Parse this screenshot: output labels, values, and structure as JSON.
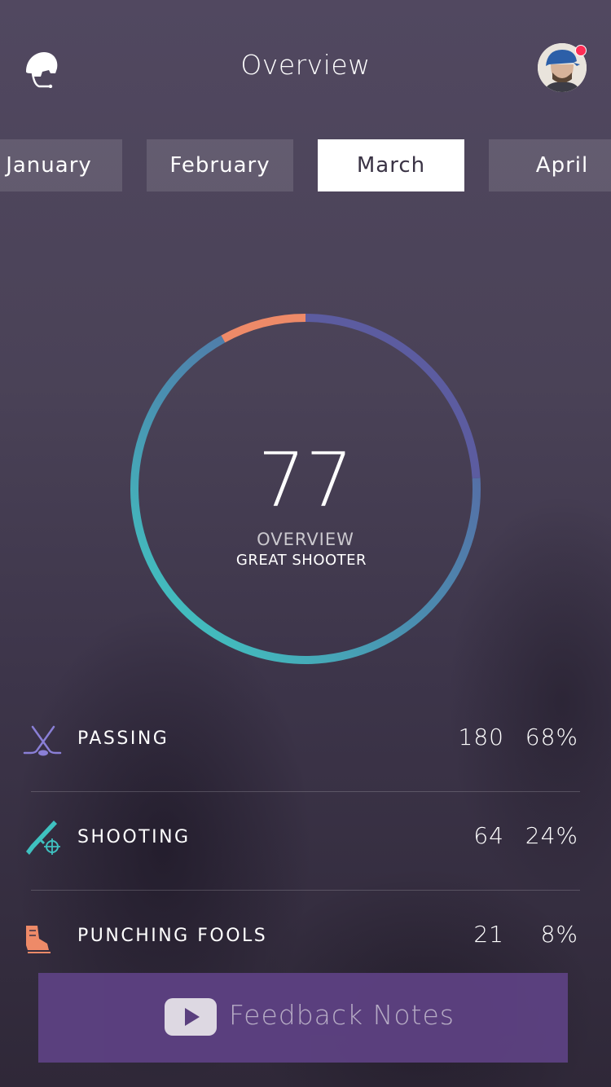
{
  "header": {
    "title": "Overview",
    "left_icon": "hockey-helmet-icon",
    "avatar_icon": "user-avatar",
    "notification_color": "#ff2d55"
  },
  "months": [
    {
      "label": "January",
      "active": false
    },
    {
      "label": "February",
      "active": false
    },
    {
      "label": "March",
      "active": true
    },
    {
      "label": "April",
      "active": false
    }
  ],
  "overview": {
    "score": "77",
    "label": "OVERVIEW",
    "subtitle": "GREAT SHOOTER",
    "ring": {
      "max": 100,
      "segments": [
        {
          "name": "passing",
          "fraction": 0.68,
          "colors": [
            "#5c5ca0",
            "#4a8fb0",
            "#3fd1c4"
          ]
        },
        {
          "name": "shooting",
          "fraction": 0.24,
          "color": "#5c5ca0"
        },
        {
          "name": "punching",
          "fraction": 0.08,
          "color": "#ee8a68"
        }
      ]
    }
  },
  "stats": [
    {
      "label": "PASSING",
      "count": "180",
      "percent": "68%",
      "icon": "hockey-sticks-icon",
      "icon_color": "#8a7fd6"
    },
    {
      "label": "SHOOTING",
      "count": "64",
      "percent": "24%",
      "icon": "rifle-target-icon",
      "icon_color": "#3fc1c0"
    },
    {
      "label": "PUNCHING FOOLS",
      "count": "21",
      "percent": "8%",
      "icon": "skate-boot-icon",
      "icon_color": "#ee8a68"
    }
  ],
  "feedback": {
    "label": "Feedback Notes",
    "icon": "play-icon",
    "bg_color": "#5d4182"
  }
}
